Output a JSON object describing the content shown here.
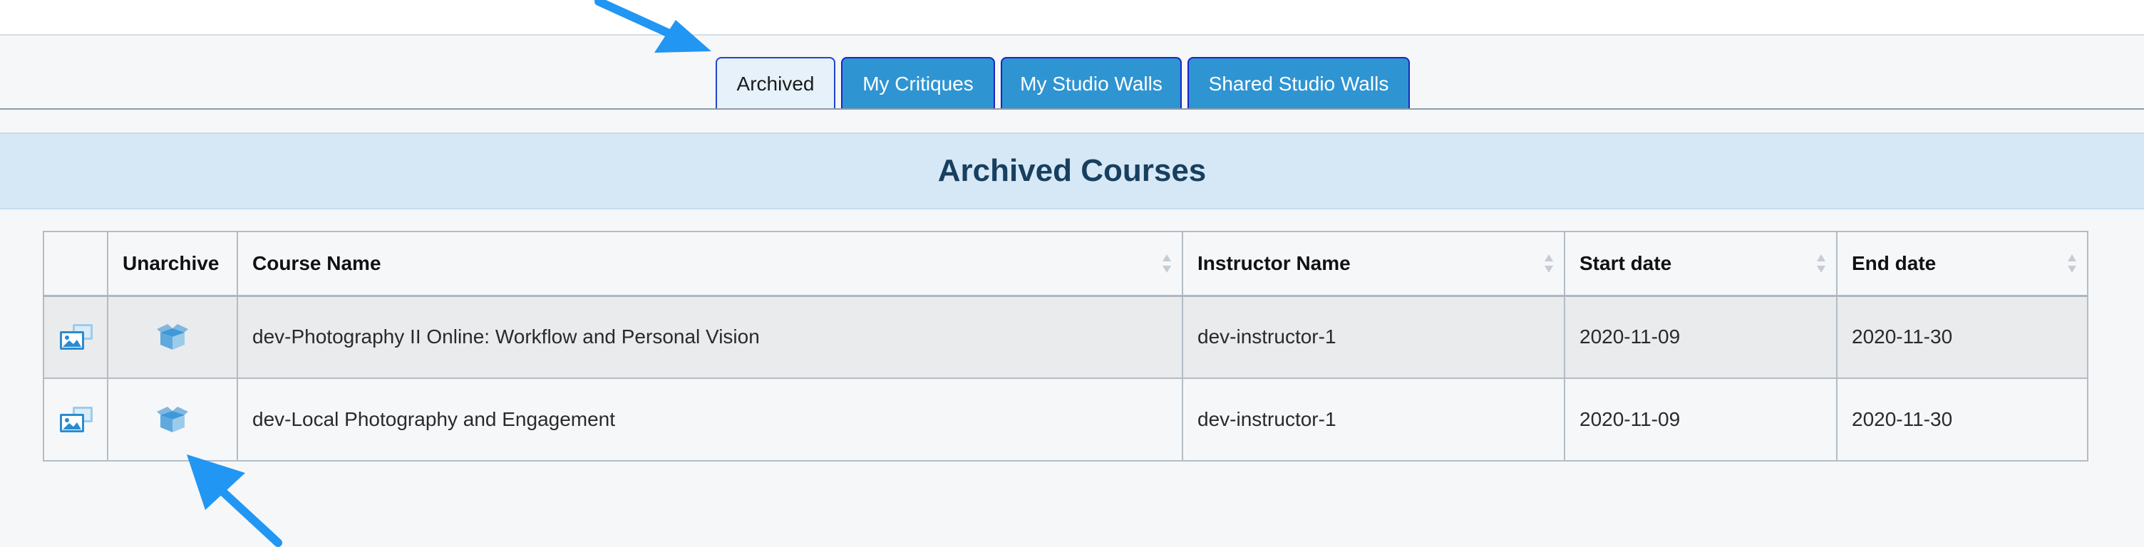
{
  "tabs": [
    {
      "label": "Archived",
      "active": true
    },
    {
      "label": "My Critiques",
      "active": false
    },
    {
      "label": "My Studio Walls",
      "active": false
    },
    {
      "label": "Shared Studio Walls",
      "active": false
    }
  ],
  "banner": {
    "title": "Archived Courses"
  },
  "table": {
    "columns": [
      "",
      "Unarchive",
      "Course Name",
      "Instructor Name",
      "Start date",
      "End date"
    ],
    "rows": [
      {
        "course_name": "dev-Photography II Online: Workflow and Personal Vision",
        "instructor": "dev-instructor-1",
        "start_date": "2020-11-09",
        "end_date": "2020-11-30"
      },
      {
        "course_name": "dev-Local Photography and Engagement",
        "instructor": "dev-instructor-1",
        "start_date": "2020-11-09",
        "end_date": "2020-11-30"
      }
    ]
  },
  "icons": {
    "gallery": "gallery-icon",
    "unarchive": "unarchive-box-icon",
    "sort": "sort-arrows-icon",
    "annotation_arrow": "pointer-arrow-icon"
  },
  "colors": {
    "tab_active_bg": "#e6f1fa",
    "tab_inactive_bg": "#2f94d2",
    "tab_border": "#1c25c8",
    "banner_bg": "#d6e8f6",
    "banner_text": "#173f5f",
    "annotation_arrow": "#2196f3"
  }
}
